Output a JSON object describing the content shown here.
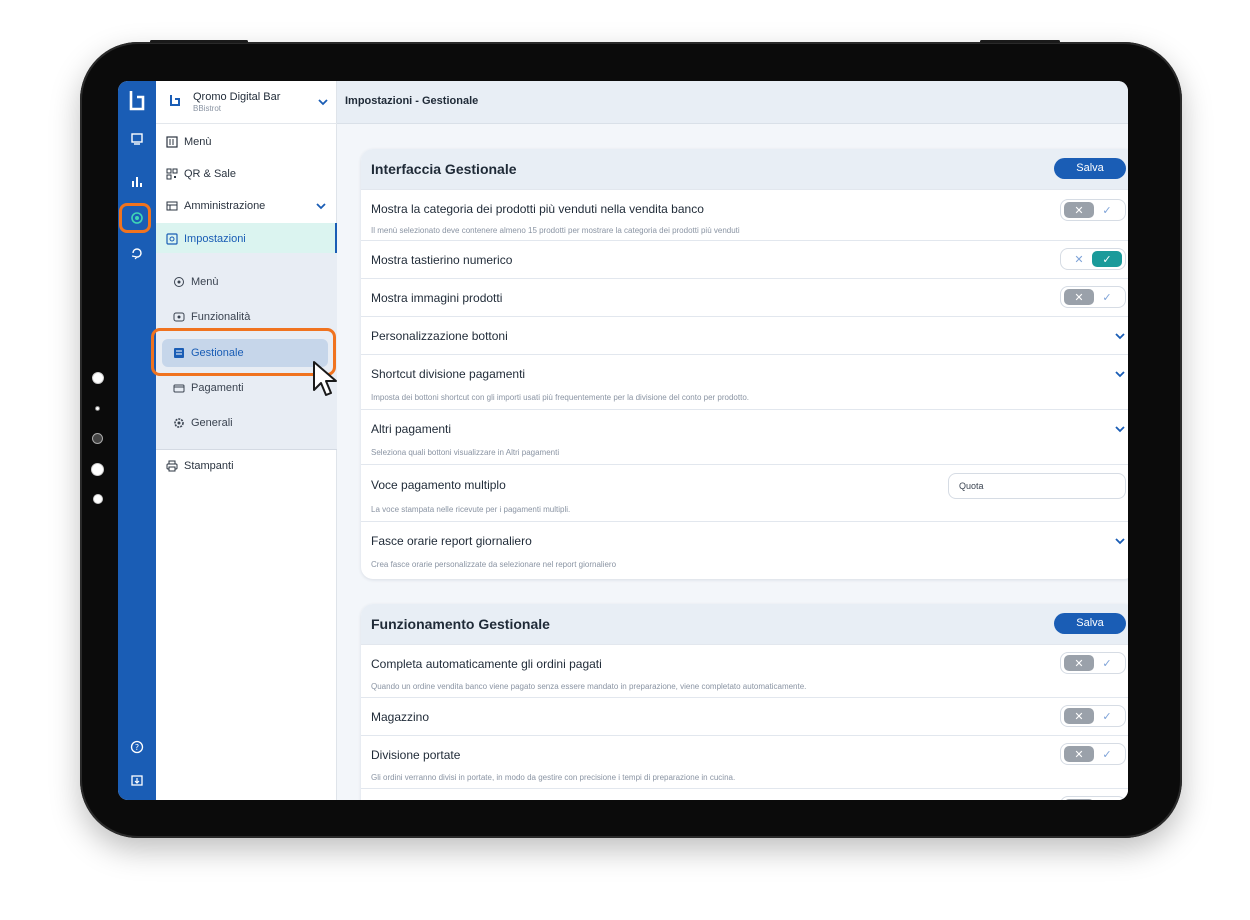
{
  "brand": {
    "name": "Qromo Digital Bar",
    "sub": "BBistrot"
  },
  "sidebar": {
    "items": [
      {
        "label": "Menù"
      },
      {
        "label": "QR & Sale"
      },
      {
        "label": "Amministrazione"
      },
      {
        "label": "Impostazioni"
      }
    ],
    "subitems": [
      {
        "label": "Menù"
      },
      {
        "label": "Funzionalità"
      },
      {
        "label": "Gestionale"
      },
      {
        "label": "Pagamenti"
      },
      {
        "label": "Generali"
      }
    ],
    "bottom": [
      {
        "label": "Stampanti"
      }
    ]
  },
  "topbar": {
    "title": "Impostazioni - Gestionale"
  },
  "card1": {
    "title": "Interfaccia Gestionale",
    "save": "Salva",
    "rows": [
      {
        "title": "Mostra la categoria dei prodotti più venduti nella vendita banco",
        "sub": "Il menù selezionato deve contenere almeno 15 prodotti per mostrare la categoria dei prodotti più venduti",
        "toggle": "off"
      },
      {
        "title": "Mostra tastierino numerico",
        "toggle": "on"
      },
      {
        "title": "Mostra immagini prodotti",
        "toggle": "off"
      },
      {
        "title": "Personalizzazione bottoni"
      },
      {
        "title": "Shortcut divisione pagamenti",
        "sub": "Imposta dei bottoni shortcut con gli importi usati più frequentemente per la divisione del conto per prodotto."
      },
      {
        "title": "Altri pagamenti",
        "sub": "Seleziona quali bottoni visualizzare in Altri pagamenti"
      },
      {
        "title": "Voce pagamento multiplo",
        "sub": "La voce stampata nelle ricevute per i pagamenti multipli.",
        "input_value": "Quota"
      },
      {
        "title": "Fasce orarie report giornaliero",
        "sub": "Crea fasce orarie personalizzate da selezionare nel report giornaliero"
      }
    ]
  },
  "card2": {
    "title": "Funzionamento Gestionale",
    "save": "Salva",
    "rows": [
      {
        "title": "Completa automaticamente gli ordini pagati",
        "sub": "Quando un ordine vendita banco viene pagato senza essere mandato in preparazione, viene completato automaticamente.",
        "toggle": "off"
      },
      {
        "title": "Magazzino",
        "toggle": "off"
      },
      {
        "title": "Divisione portate",
        "sub": "Gli ordini verranno divisi in portate, in modo da gestire con precisione i tempi di preparazione in cucina.",
        "toggle": "off"
      }
    ]
  },
  "toggle_glyphs": {
    "off": "✕",
    "on": "✓"
  },
  "colors": {
    "brand": "#1a5db5",
    "highlight": "#f0731f",
    "toggle_on": "#1a9a9a",
    "toggle_off": "#9aa1aa",
    "active_nav": "#dbf4f0"
  }
}
